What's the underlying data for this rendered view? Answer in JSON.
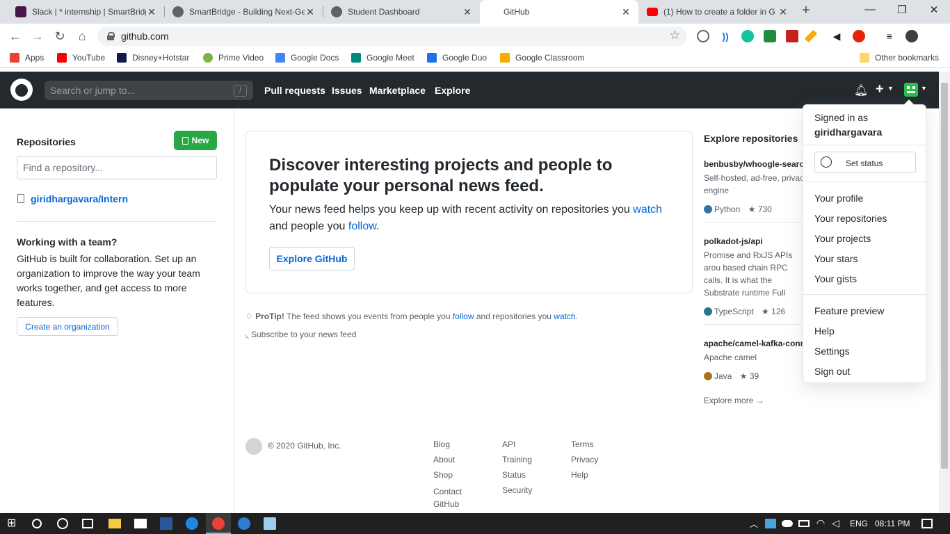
{
  "browser": {
    "tabs": [
      {
        "title": "Slack | * internship | SmartBridge",
        "favicon_color": "#4a154b"
      },
      {
        "title": "SmartBridge - Building Next-Gen",
        "favicon_color": "#5f6368"
      },
      {
        "title": "Student Dashboard",
        "favicon_color": "#5f6368"
      },
      {
        "title": "GitHub",
        "favicon_color": "#ffffff",
        "active": true
      },
      {
        "title": "(1) How to create a folder in G",
        "favicon_color": "#ff0000"
      }
    ],
    "new_tab": "+",
    "url": "github.com",
    "bookmarks": [
      {
        "label": "Apps",
        "color": "#ea4335"
      },
      {
        "label": "YouTube",
        "color": "#ff0000"
      },
      {
        "label": "Disney+Hotstar",
        "color": "#0f1b4c"
      },
      {
        "label": "Prime Video",
        "color": "#7cb342"
      },
      {
        "label": "Google Docs",
        "color": "#4285f4"
      },
      {
        "label": "Google Meet",
        "color": "#00897b"
      },
      {
        "label": "Google Duo",
        "color": "#1a73e8"
      },
      {
        "label": "Google Classroom",
        "color": "#f9ab00"
      }
    ],
    "other_bookmarks": "Other bookmarks",
    "extension_badge": "1"
  },
  "github": {
    "search_placeholder": "Search or jump to...",
    "search_key": "/",
    "nav": [
      "Pull requests",
      "Issues",
      "Marketplace",
      "Explore"
    ],
    "sidebar": {
      "repos_title": "Repositories",
      "new_label": "New",
      "find_placeholder": "Find a repository...",
      "repo_name": "giridhargavara/Intern",
      "team_title": "Working with a team?",
      "team_text": "GitHub is built for collaboration. Set up an organization to improve the way your team works together, and get access to more features.",
      "create_org": "Create an organization"
    },
    "feed": {
      "heading": "Discover interesting projects and people to populate your personal news feed.",
      "text_before": "Your news feed helps you keep up with recent activity on repositories you",
      "watch": "watch",
      "text_mid": "and people you",
      "follow": "follow",
      "text_end": ".",
      "button": "Explore GitHub"
    },
    "protip": {
      "label": "ProTip!",
      "text1": "The feed shows you events from people you",
      "follow": "follow",
      "text2": "and repositories you",
      "watch": "watch",
      "end": "."
    },
    "subscribe": "Subscribe to your news feed",
    "explore": {
      "title": "Explore repositories",
      "repos": [
        {
          "name": "benbusby/whoogle-search",
          "desc": "Self-hosted, ad-free, privac engine",
          "lang": "Python",
          "lang_color": "#3572a5",
          "stars": "730"
        },
        {
          "name": "polkadot-js/api",
          "desc": "Promise and RxJS APIs arou based chain RPC calls. It is what the Substrate runtime Full documentation & ex...",
          "lang": "TypeScript",
          "lang_color": "#2b7489",
          "stars": "126"
        },
        {
          "name": "apache/camel-kafka-conn",
          "desc": "Apache camel",
          "lang": "Java",
          "lang_color": "#b07219",
          "stars": "39"
        }
      ],
      "more": "Explore more →"
    },
    "dropdown": {
      "signed_in_as": "Signed in as",
      "username": "giridhargavara",
      "set_status": "Set status",
      "group1": [
        "Your profile",
        "Your repositories",
        "Your projects",
        "Your stars",
        "Your gists"
      ],
      "group2": [
        "Feature preview",
        "Help",
        "Settings",
        "Sign out"
      ]
    },
    "footer": {
      "copyright": "© 2020 GitHub, Inc.",
      "col1": [
        "Blog",
        "About",
        "Shop",
        "Contact GitHub"
      ],
      "col2": [
        "API",
        "Training",
        "Status",
        "Security"
      ],
      "col3": [
        "Terms",
        "Privacy",
        "Help"
      ]
    }
  },
  "taskbar": {
    "lang": "ENG",
    "time": "08:11 PM"
  }
}
